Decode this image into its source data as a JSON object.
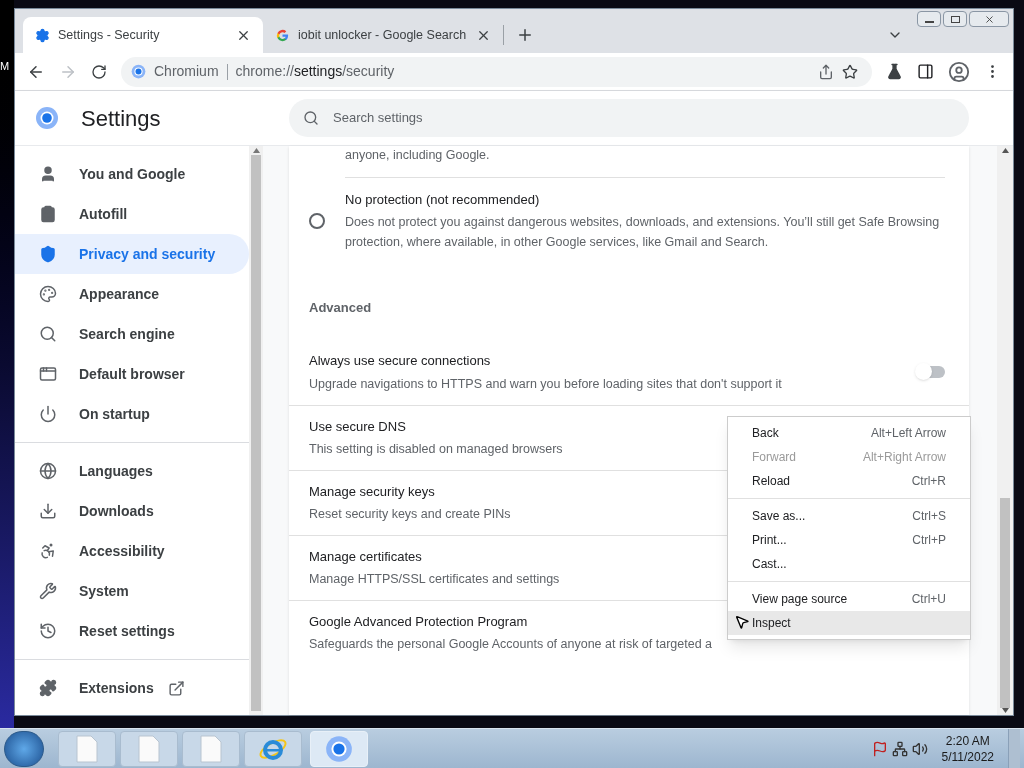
{
  "desktop": {
    "edge_text": "M"
  },
  "tabs": [
    {
      "title": "Settings - Security",
      "selected": true,
      "kind": "settings"
    },
    {
      "title": "iobit unlocker - Google Search",
      "selected": false,
      "kind": "google"
    }
  ],
  "address_bar": {
    "site": "Chromium",
    "url_prefix": "chrome://",
    "url_host": "settings",
    "url_path": "/security"
  },
  "header": {
    "title": "Settings",
    "search_placeholder": "Search settings"
  },
  "sidebar": {
    "groups": [
      [
        {
          "label": "You and Google",
          "selected": false
        },
        {
          "label": "Autofill",
          "selected": false
        },
        {
          "label": "Privacy and security",
          "selected": true
        },
        {
          "label": "Appearance",
          "selected": false
        },
        {
          "label": "Search engine",
          "selected": false
        },
        {
          "label": "Default browser",
          "selected": false
        },
        {
          "label": "On startup",
          "selected": false
        }
      ],
      [
        {
          "label": "Languages",
          "selected": false
        },
        {
          "label": "Downloads",
          "selected": false
        },
        {
          "label": "Accessibility",
          "selected": false
        },
        {
          "label": "System",
          "selected": false
        },
        {
          "label": "Reset settings",
          "selected": false
        }
      ],
      [
        {
          "label": "Extensions",
          "selected": false
        }
      ]
    ]
  },
  "content": {
    "partial_text": "anyone, including Google.",
    "radio": {
      "title": "No protection (not recommended)",
      "description": "Does not protect you against dangerous websites, downloads, and extensions. You’ll still get Safe Browsing protection, where available, in other Google services, like Gmail and Search.",
      "checked": false
    },
    "section_heading": "Advanced",
    "rows": [
      {
        "kind": "toggle",
        "title": "Always use secure connections",
        "subtitle": "Upgrade navigations to HTTPS and warn you before loading sites that don't support it",
        "on": false
      },
      {
        "kind": "plain",
        "title": "Use secure DNS",
        "subtitle": "This setting is disabled on managed browsers"
      },
      {
        "kind": "plain",
        "title": "Manage security keys",
        "subtitle": "Reset security keys and create PINs"
      },
      {
        "kind": "plain",
        "title": "Manage certificates",
        "subtitle": "Manage HTTPS/SSL certificates and settings"
      },
      {
        "kind": "plain",
        "title": "Google Advanced Protection Program",
        "subtitle": "Safeguards the personal Google Accounts of anyone at risk of targeted a"
      }
    ]
  },
  "context_menu": {
    "groups": [
      [
        {
          "label": "Back",
          "shortcut": "Alt+Left Arrow",
          "disabled": false,
          "selected": false
        },
        {
          "label": "Forward",
          "shortcut": "Alt+Right Arrow",
          "disabled": true,
          "selected": false
        },
        {
          "label": "Reload",
          "shortcut": "Ctrl+R",
          "disabled": false,
          "selected": false
        }
      ],
      [
        {
          "label": "Save as...",
          "shortcut": "Ctrl+S",
          "disabled": false,
          "selected": false
        },
        {
          "label": "Print...",
          "shortcut": "Ctrl+P",
          "disabled": false,
          "selected": false
        },
        {
          "label": "Cast...",
          "disabled": false,
          "selected": false
        }
      ],
      [
        {
          "label": "View page source",
          "shortcut": "Ctrl+U",
          "disabled": false,
          "selected": false
        },
        {
          "label": "Inspect",
          "disabled": false,
          "selected": true
        }
      ]
    ]
  },
  "taskbar": {
    "buttons": [
      {
        "kind": "document",
        "selected": false
      },
      {
        "kind": "document",
        "selected": false
      },
      {
        "kind": "document",
        "selected": false
      },
      {
        "kind": "ie",
        "selected": false
      },
      {
        "kind": "chromium",
        "selected": true
      }
    ],
    "time": "2:20 AM",
    "date": "5/11/2022"
  }
}
